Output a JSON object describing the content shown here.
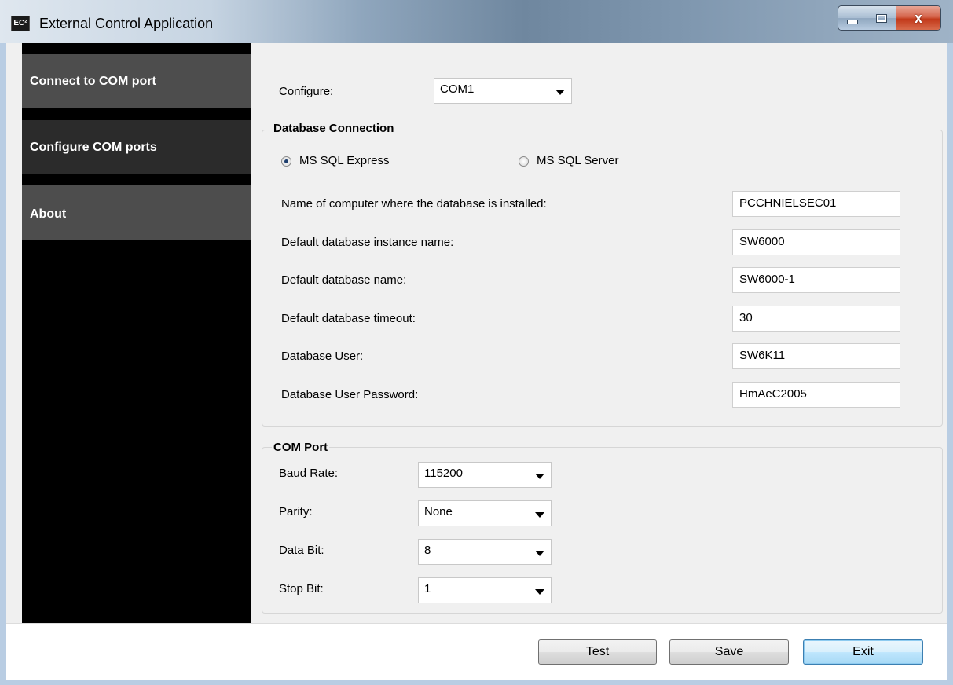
{
  "window": {
    "title": "External Control Application",
    "icon_text": "EC²",
    "controls": {
      "minimize": "minimize",
      "maximize": "maximize",
      "close": "x"
    }
  },
  "sidebar": {
    "items": [
      {
        "label": "Connect to COM port"
      },
      {
        "label": "Configure COM ports"
      },
      {
        "label": "About"
      }
    ]
  },
  "configure": {
    "label": "Configure:",
    "value": "COM1"
  },
  "database_connection": {
    "title": "Database Connection",
    "radio_express": "MS SQL Express",
    "radio_server": "MS SQL Server",
    "selected": "MS SQL Express",
    "fields": [
      {
        "label": "Name of computer where the database is installed:",
        "value": "PCCHNIELSEC01"
      },
      {
        "label": "Default database instance name:",
        "value": "SW6000"
      },
      {
        "label": "Default database name:",
        "value": "SW6000-1"
      },
      {
        "label": "Default database timeout:",
        "value": "30"
      },
      {
        "label": "Database User:",
        "value": "SW6K11"
      },
      {
        "label": "Database User Password:",
        "value": "HmAeC2005"
      }
    ]
  },
  "com_port": {
    "title": "COM Port",
    "fields": [
      {
        "label": "Baud Rate:",
        "value": "115200"
      },
      {
        "label": "Parity:",
        "value": "None"
      },
      {
        "label": "Data Bit:",
        "value": "8"
      },
      {
        "label": "Stop Bit:",
        "value": "1"
      }
    ]
  },
  "footer": {
    "test": "Test",
    "save": "Save",
    "exit": "Exit"
  },
  "colors": {
    "sidebar_bg": "#000000",
    "nav_item": "#4d4d4d",
    "nav_item_alt": "#2b2b2b",
    "form_bg": "#f0f0f0"
  }
}
